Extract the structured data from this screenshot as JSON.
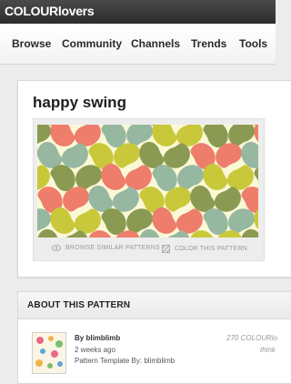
{
  "header": {
    "logo": "COLOURlovers"
  },
  "nav": {
    "items": [
      {
        "label": "Browse"
      },
      {
        "label": "Community"
      },
      {
        "label": "Channels"
      },
      {
        "label": "Trends"
      },
      {
        "label": "Tools"
      }
    ]
  },
  "pattern": {
    "title": "happy swing",
    "actions": {
      "browse_similar": "BROWSE SIMILAR PATTERNS",
      "color_this": "COLOR THIS PATTERN"
    },
    "colors": {
      "background": "#fbf8d6",
      "sage": "#96b7a0",
      "olive": "#8a9a52",
      "salmon": "#ee7d6b",
      "lime": "#c8c83a"
    }
  },
  "about": {
    "heading": "ABOUT THIS PATTERN",
    "by_label": "By",
    "author": "blimblimb",
    "posted": "2 weeks ago",
    "template": "Pattern Template By: blimblimb",
    "loves": "270 COLOURlo",
    "right_note": "think"
  }
}
